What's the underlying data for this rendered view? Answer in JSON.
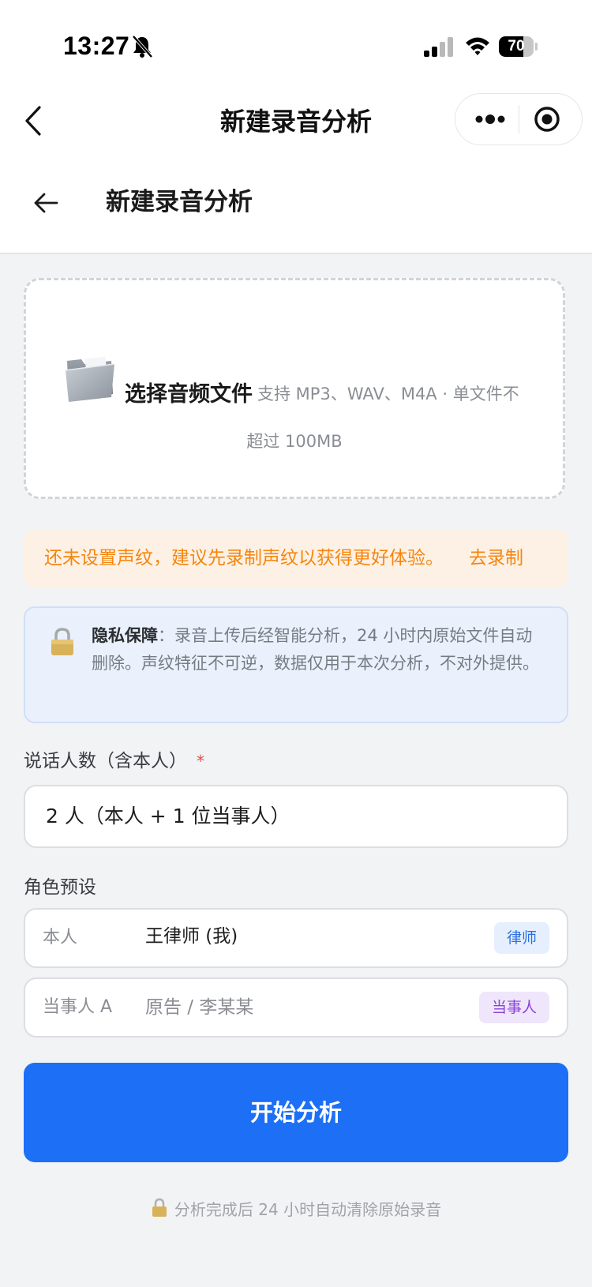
{
  "status_bar": {
    "time": "13:27",
    "battery": "70",
    "battery_level": 0.7
  },
  "nav_bar": {
    "title": "新建录音分析"
  },
  "page_header": {
    "title": "新建录音分析"
  },
  "upload": {
    "title": "选择音频文件",
    "desc_line1": "支持 MP3、WAV、M4A · 单文件不",
    "desc_line2": "超过 100MB"
  },
  "warning": {
    "text": "还未设置声纹，建议先录制声纹以获得更好体验。",
    "link": "去录制"
  },
  "privacy": {
    "title": "隐私保障",
    "separator": "：",
    "text": "录音上传后经智能分析，24 小时内原始文件自动删除。声纹特征不可逆，数据仅用于本次分析，不对外提供。"
  },
  "speakers": {
    "label": "说话人数（含本人）",
    "required_mark": "*",
    "value": "2 人（本人 + 1 位当事人）"
  },
  "roles": {
    "label": "角色预设",
    "items": [
      {
        "label": "本人",
        "value": "王律师 (我)",
        "tag": "律师"
      },
      {
        "label": "当事人 A",
        "placeholder": "原告 / 李某某",
        "tag": "当事人"
      }
    ]
  },
  "start_button": "开始分析",
  "footer_note": "分析完成后 24 小时自动清除原始录音",
  "colors": {
    "primary": "#1d6ff5",
    "warning": "#f5860e",
    "privacy_bg": "#eaf1fd"
  }
}
